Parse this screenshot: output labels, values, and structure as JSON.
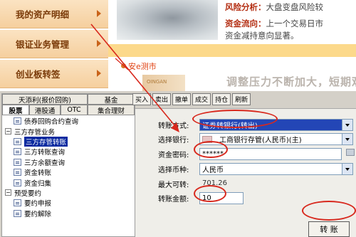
{
  "left_menu": {
    "items": [
      {
        "label": "我的资产明细"
      },
      {
        "label": "银证业务管理"
      },
      {
        "label": "创业板转签"
      }
    ]
  },
  "news": {
    "image_caption": "",
    "risk_label": "风险分析：",
    "risk_text": "大盘变盘风险较",
    "funds_label": "资金流向：",
    "funds_text": "上一个交易日市",
    "funds_text2": "资金减持意向显著。",
    "sub_title": "安e测市",
    "headline": "调整压力不断加大，短期观",
    "banner_img_text": "OINGAN"
  },
  "tree": {
    "tabs_row1": [
      "天添利(报价回购)",
      "基金"
    ],
    "tabs_row2": [
      "股票",
      "港股通",
      "OTC",
      "集合理财"
    ],
    "items": [
      {
        "label": "债券回购合约查询",
        "level": 2,
        "type": "doc"
      },
      {
        "label": "三方存管业务",
        "level": 1,
        "type": "folder"
      },
      {
        "label": "三方存管转账",
        "level": 2,
        "type": "doc",
        "selected": true
      },
      {
        "label": "三方转账查询",
        "level": 2,
        "type": "doc"
      },
      {
        "label": "三方余额查询",
        "level": 2,
        "type": "doc"
      },
      {
        "label": "资金转账",
        "level": 2,
        "type": "doc"
      },
      {
        "label": "资金归集",
        "level": 2,
        "type": "doc"
      },
      {
        "label": "预受要约",
        "level": 1,
        "type": "folder"
      },
      {
        "label": "要约申报",
        "level": 2,
        "type": "doc"
      },
      {
        "label": "要约解除",
        "level": 2,
        "type": "doc"
      }
    ]
  },
  "toolbar": {
    "buttons": [
      "买入",
      "卖出",
      "撤单",
      "成交",
      "持仓",
      "刷新"
    ]
  },
  "form": {
    "transfer_mode_label": "转账方式:",
    "transfer_mode_value": "证券转银行(转出)",
    "bank_label": "选择银行:",
    "bank_value": "工商银行存管(人民币)(主)",
    "password_label": "资金密码:",
    "password_value": "******",
    "currency_label": "选择币种:",
    "currency_value": "人民币",
    "max_label": "最大可转:",
    "max_value": "701.26",
    "amount_label": "转账金额:",
    "amount_value": "10",
    "submit_label": "转 账"
  },
  "colors": {
    "menu_text": "#7a3a08",
    "annotation_red": "#d8281d",
    "selection_blue": "#2346b6"
  }
}
